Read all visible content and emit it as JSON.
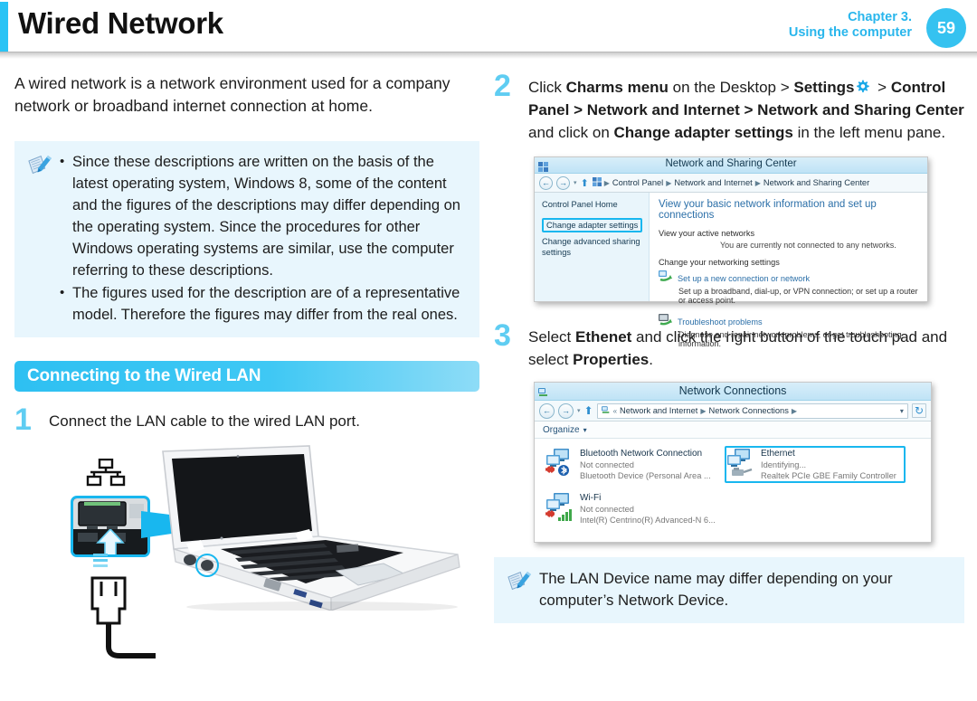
{
  "header": {
    "title": "Wired Network",
    "chapter_line1": "Chapter 3.",
    "chapter_line2": "Using the computer",
    "page_number": "59",
    "accent_color": "#29c3f5",
    "bubble_color": "#35c2f0"
  },
  "left": {
    "intro": "A wired network is a network environment used for a company network or broadband internet connection at home.",
    "note": {
      "icon": "note-pen-icon",
      "bullets": [
        "Since these descriptions are written on the basis of the latest operating system, Windows 8, some of the content and the figures of the descriptions may differ depending on the operating system. Since the procedures for other Windows operating systems are similar, use the computer referring to these descriptions.",
        "The figures used for the description are of a representative model. Therefore the figures may differ from the real ones."
      ],
      "bullet_char": "•"
    },
    "section_bar": "Connecting to the Wired LAN",
    "step1": {
      "number": "1",
      "text": "Connect the LAN cable to the wired LAN port."
    },
    "figure": {
      "lan_port_icon": "lan-network-port-icon",
      "port_photo": "lan-port-closeup-photo",
      "arrow": "insert-arrow-icon",
      "cable_plug": "rj45-cable-plug-icon",
      "laptop": "laptop-illustration",
      "callout_color": "#18b7ef"
    }
  },
  "right": {
    "step2": {
      "number": "2",
      "parts": [
        {
          "t": "Click ",
          "b": false
        },
        {
          "t": "Charms menu",
          "b": true
        },
        {
          "t": " on the Desktop > ",
          "b": false
        },
        {
          "t": "Settings",
          "b": true
        },
        {
          "t": "gear",
          "b": "icon"
        },
        {
          "t": " > ",
          "b": false
        },
        {
          "t": "Control Panel > Network and Internet > Network and Sharing Center",
          "b": true
        },
        {
          "t": " and click on ",
          "b": false
        },
        {
          "t": "Change adapter settings",
          "b": true
        },
        {
          "t": " in the left menu pane.",
          "b": false
        }
      ],
      "gear_icon": "settings-gear-icon"
    },
    "nsc_window": {
      "icon": "network-sharing-center-icon",
      "title": "Network and Sharing Center",
      "back_icon": "back-arrow-icon",
      "forward_icon": "forward-arrow-icon",
      "dropdown_icon": "chevron-down-icon",
      "up_icon": "up-arrow-icon",
      "breadcrumb": [
        "Control Panel",
        "Network and Internet",
        "Network and Sharing Center"
      ],
      "sidebar": {
        "home": "Control Panel Home",
        "highlighted": "Change adapter settings",
        "advanced": "Change advanced sharing settings"
      },
      "heading": "View your basic network information and set up connections",
      "active_networks_label": "View your active networks",
      "active_networks_value": "You are currently not connected to any networks.",
      "change_settings_label": "Change your networking settings",
      "links": [
        {
          "icon": "new-connection-icon",
          "title": "Set up a new connection or network",
          "desc": "Set up a broadband, dial-up, or VPN connection; or set up a router or access point."
        },
        {
          "icon": "troubleshoot-icon",
          "title": "Troubleshoot problems",
          "desc": "Diagnose and repair network problems, or get troubleshooting information."
        }
      ]
    },
    "step3": {
      "number": "3",
      "parts": [
        {
          "t": "Select ",
          "b": false
        },
        {
          "t": "Ethenet",
          "b": true
        },
        {
          "t": " and click the right button of the touch pad and select ",
          "b": false
        },
        {
          "t": "Properties",
          "b": true
        },
        {
          "t": ".",
          "b": false
        }
      ]
    },
    "nc_window": {
      "icon": "network-connections-icon",
      "title": "Network Connections",
      "back_icon": "back-arrow-icon",
      "forward_icon": "forward-arrow-icon",
      "up_icon": "up-arrow-icon",
      "refresh_icon": "refresh-icon",
      "dropdown_icon": "chevron-down-icon",
      "breadcrumb": [
        "Network and Internet",
        "Network Connections"
      ],
      "toolbar": {
        "organize": "Organize",
        "organize_caret": "▾"
      },
      "connections": [
        {
          "name": "Bluetooth Network Connection",
          "status": "Not connected",
          "device": "Bluetooth Device (Personal Area ...",
          "icon": "network-adapter-icon",
          "badge": "bluetooth-icon",
          "error": "red-x-icon",
          "selected": false
        },
        {
          "name": "Ethernet",
          "status": "Identifying...",
          "device": "Realtek PCIe GBE Family Controller",
          "icon": "network-adapter-icon",
          "badge": "ethernet-cable-icon",
          "error": "",
          "selected": true
        },
        {
          "name": "Wi-Fi",
          "status": "Not connected",
          "device": "Intel(R) Centrino(R) Advanced-N 6...",
          "icon": "network-adapter-icon",
          "badge": "wifi-signal-icon",
          "error": "red-x-icon",
          "selected": false
        }
      ],
      "selection_color": "#18b7ef"
    },
    "bottom_note": {
      "icon": "note-pen-icon",
      "text": "The LAN Device name may differ depending on your computer’s Network Device."
    }
  }
}
